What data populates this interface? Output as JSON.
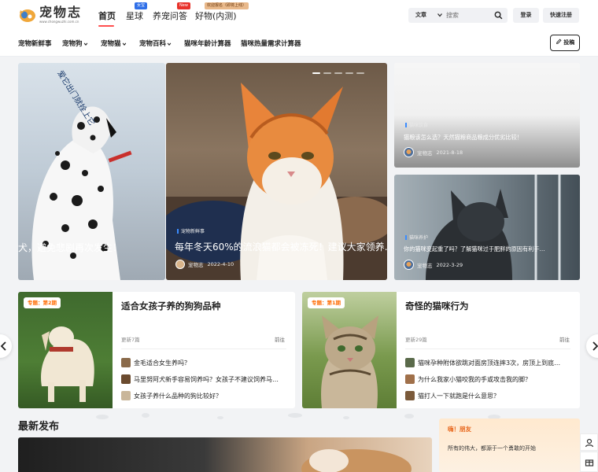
{
  "site": {
    "logo_name": "宠物志",
    "logo_url": "www.chongwuzhi.com.cn"
  },
  "nav": [
    {
      "label": "首页",
      "active": true
    },
    {
      "label": "星球",
      "badge": "女宝"
    },
    {
      "label": "养宠问答",
      "badge": "New"
    },
    {
      "label": "好物(内测)",
      "badge": "欢迎报名（即将上线）"
    }
  ],
  "search": {
    "category": "文章",
    "placeholder": "搜索"
  },
  "auth": {
    "login": "登录",
    "register": "快速注册"
  },
  "subnav": [
    "宠物新鲜事",
    "宠物狗",
    "宠物猫",
    "宠物百科",
    "猫咪年龄计算器",
    "猫咪热量需求计算器"
  ],
  "post_button": "投稿",
  "slider": {
    "left_overlay": "爱它出门就拴上它",
    "left_text": "犬，避免悲剧再次发生！",
    "center_tag": "宠物新鲜事",
    "center_title": "每年冬天60%的流浪猫都会被冻死！建议大家领养…",
    "center_author": "宠物志",
    "center_date": "2022-4-10"
  },
  "side_cards": [
    {
      "tag": "猫咪饮食",
      "title": "猫粮该怎么选？天然猫粮商品粮成分优劣比较！",
      "author": "宠物志",
      "date": "2021-8-18"
    },
    {
      "tag": "猫咪养护",
      "title": "你的猫咪变起重了吗？了解猫咪过于肥胖的原因有利于…",
      "author": "宠物志",
      "date": "2022-3-29"
    }
  ],
  "topics": [
    {
      "badge": "专题：第2期",
      "title": "适合女孩子养的狗狗品种",
      "updated": "更新7篇",
      "go": "前往",
      "items": [
        "金毛适合女生养吗？",
        "马里努阿犬新手容易饲养吗？女孩子不建议饲养马…",
        "女孩子养什么品种的狗比较好？"
      ]
    },
    {
      "badge": "专题：第1期",
      "title": "奇怪的猫咪行为",
      "updated": "更新29篇",
      "go": "前往",
      "items": [
        "猫咪孕种附体欲跳对面房顶连摔3次，房顶上到底…",
        "为什么我家小猫咬我的手或攻击我的脚？",
        "猫打人一下就跑是什么意思？"
      ]
    }
  ],
  "latest_title": "最新发布",
  "promo": {
    "greeting": "嗨！朋友",
    "text": "所有的伟大，都源于一个勇敢的开始"
  },
  "colors": {
    "accent": "#ff4f4f",
    "topic_badge": "#ff6a00",
    "tag_bar": "#3b8cff"
  }
}
